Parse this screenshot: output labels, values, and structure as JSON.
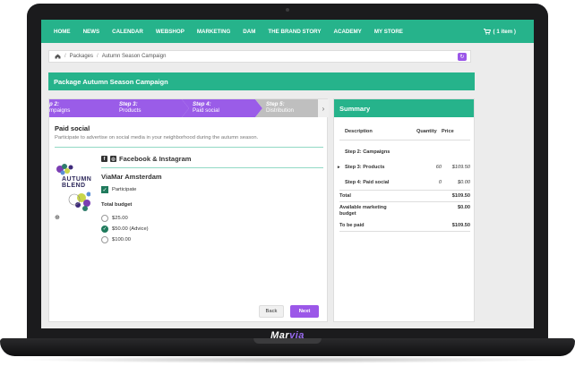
{
  "nav": {
    "items": [
      "HOME",
      "NEWS",
      "CALENDAR",
      "WEBSHOP",
      "MARKETING",
      "DAM",
      "THE BRAND STORY",
      "ACADEMY",
      "MY STORE"
    ],
    "cart": "( 1 item )"
  },
  "breadcrumb": {
    "items": [
      "Packages",
      "Autumn Season Campaign"
    ]
  },
  "package_title": "Package Autumn Season Campaign",
  "steps": [
    {
      "title": "p 2:",
      "subtitle": "mpaigns"
    },
    {
      "title": "Step 3:",
      "subtitle": "Products"
    },
    {
      "title": "Step 4:",
      "subtitle": "Paid social"
    },
    {
      "title": "Step 5:",
      "subtitle": "Distribution"
    }
  ],
  "section": {
    "title": "Paid social",
    "description": "Participate to advertise on social media in your neighborhood during the autumn season."
  },
  "social": {
    "label": "Facebook & Instagram",
    "thumb_text": "AUTUMN BLEND"
  },
  "store": {
    "name": "ViaMar Amsterdam",
    "participate_label": "Participate",
    "participate_checked": true
  },
  "budget": {
    "label": "Total budget",
    "options": [
      "$25.00",
      "$50.00 (Advice)",
      "$100.00"
    ],
    "selected": 1
  },
  "buttons": {
    "back": "Back",
    "next": "Next"
  },
  "summary": {
    "title": "Summary",
    "columns": {
      "description": "Description",
      "quantity": "Quantity",
      "price": "Price"
    },
    "rows": [
      {
        "description": "Step 2: Campaigns",
        "quantity": "",
        "price": ""
      },
      {
        "description": "Step 3: Products",
        "quantity": "60",
        "price": "$109.50"
      },
      {
        "description": "Step 4: Paid social",
        "quantity": "0",
        "price": "$0.00"
      }
    ],
    "totals": [
      {
        "label": "Total",
        "value": "$109.50"
      },
      {
        "label": "Available marketing budget",
        "value": "$0.00"
      },
      {
        "label": "To be paid",
        "value": "$109.50"
      }
    ]
  },
  "brand": {
    "part1": "Mar",
    "part2": "via"
  },
  "colors": {
    "green": "#26b38b",
    "purple": "#9a5ce8",
    "dark_green": "#1f7a5c"
  }
}
